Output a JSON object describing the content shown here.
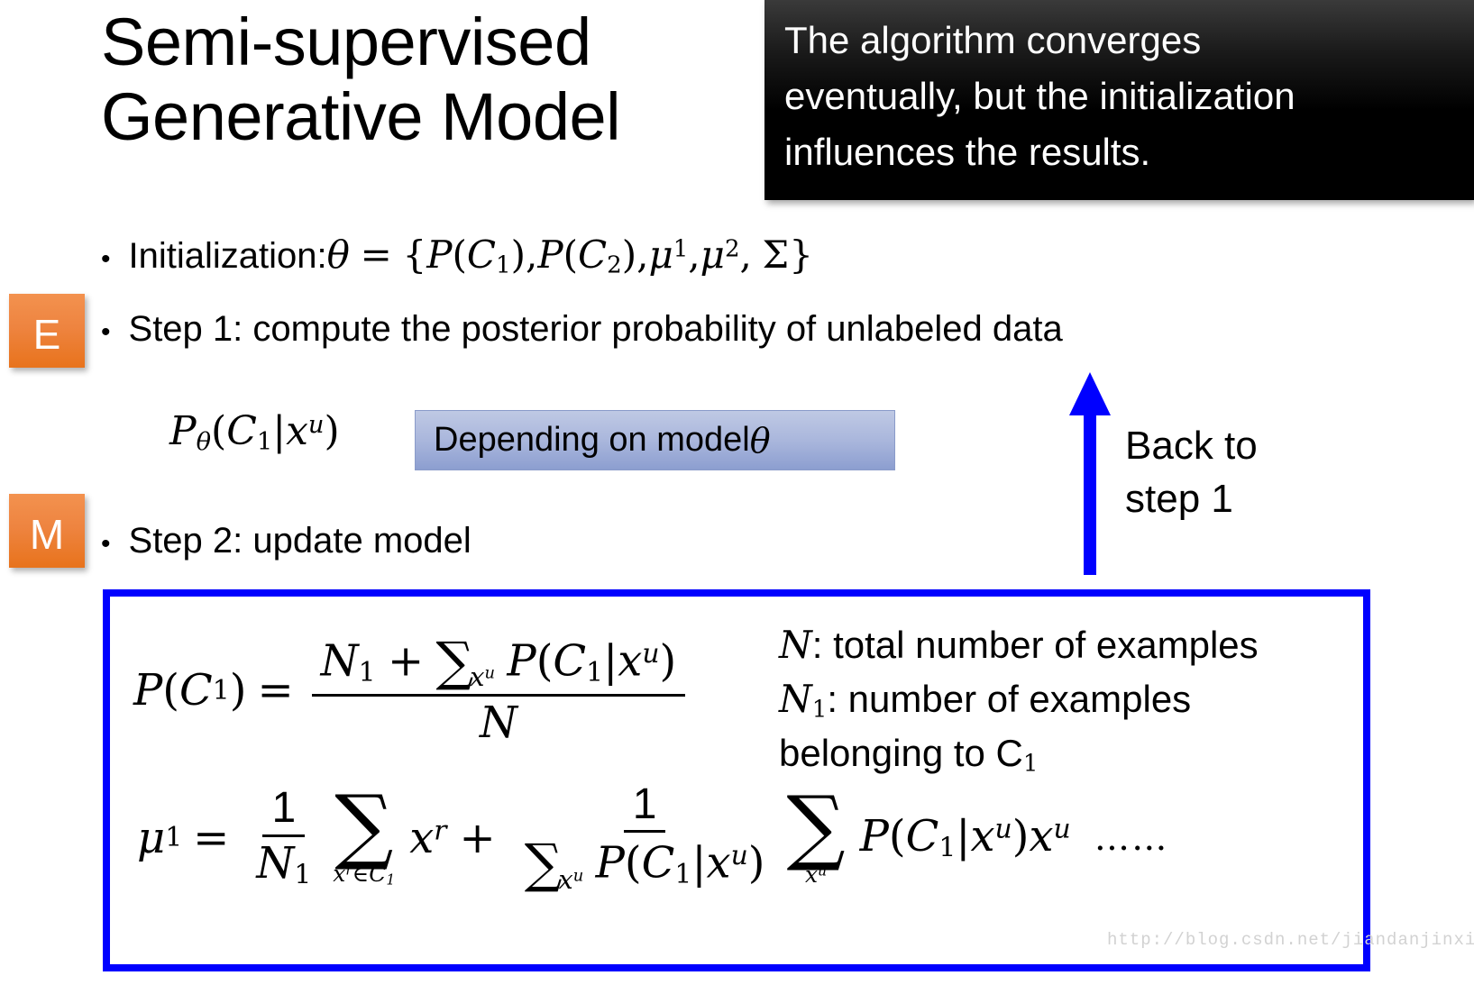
{
  "slide": {
    "title_line1": "Semi-supervised",
    "title_line2": "Generative Model",
    "watermark": "http://blog.csdn.net/jiandanjinxin"
  },
  "callout": {
    "line1": "The algorithm converges",
    "line2": "eventually, but the initialization",
    "line3": "influences the results.",
    "background": "#000000",
    "text_color": "#ffffff"
  },
  "badges": {
    "e_label": "E",
    "m_label": "M",
    "color_top": "#F3924F",
    "color_bottom": "#E8731C"
  },
  "bullets": {
    "dot": "•",
    "init_label": "Initialization:",
    "init_formula": {
      "theta": "θ",
      "equals": "=",
      "open_brace": "{",
      "p1": "P",
      "c1": "C",
      "c1_sub": "1",
      "p2": "P",
      "c2": "C",
      "c2_sub": "2",
      "mu": "μ",
      "mu1_sup": "1",
      "mu2_sup": "2",
      "sigma": "Σ",
      "close_brace": "}",
      "comma": ","
    },
    "step1_text": "Step 1: compute the posterior probability of unlabeled data",
    "step2_text": "Step 2: update model"
  },
  "posterior": {
    "p": "P",
    "theta_sub": "θ",
    "c": "C",
    "c_sub": "1",
    "bar": "|",
    "x": "x",
    "x_sup": "u"
  },
  "depend_box": {
    "text_prefix": "Depending on model ",
    "theta": "θ",
    "fill_top": "#BFC9E4",
    "fill_bottom": "#8C9ED0"
  },
  "back_to_step": {
    "line1": "Back to",
    "line2": "step 1",
    "arrow_color": "#0000FF",
    "arrow_direction": "up"
  },
  "formula_box": {
    "border_color": "#0000FF",
    "equation_pc1": {
      "lhs_p": "P",
      "lhs_c": "C",
      "lhs_c_sub": "1",
      "equals": "=",
      "num_n1": "N",
      "num_n1_sub": "1",
      "plus": "+",
      "sum": "∑",
      "sum_lim_x": "x",
      "sum_lim_sup": "u",
      "num_p": "P",
      "num_c": "C",
      "num_c_sub": "1",
      "bar": "|",
      "num_x": "x",
      "num_x_sup": "u",
      "den_n": "N"
    },
    "equation_mu1": {
      "mu": "μ",
      "mu_sup": "1",
      "equals": "=",
      "frac1_num": "1",
      "frac1_den_n": "N",
      "frac1_den_sub": "1",
      "sum1": "∑",
      "sum1_lim_x": "x",
      "sum1_lim_sup": "r",
      "sum1_lim_in": "∈",
      "sum1_lim_c": "C",
      "sum1_lim_c_sub": "1",
      "term_x": "x",
      "term_x_sup": "r",
      "plus": "+",
      "frac2_num": "1",
      "frac2_den_sum": "∑",
      "frac2_den_lim_x": "x",
      "frac2_den_lim_sup": "u",
      "frac2_den_p": "P",
      "frac2_den_c": "C",
      "frac2_den_c_sub": "1",
      "bar": "|",
      "frac2_den_x": "x",
      "frac2_den_x_sup": "u",
      "sum2": "∑",
      "sum2_lim_x": "x",
      "sum2_lim_sup": "u",
      "tail_p": "P",
      "tail_c": "C",
      "tail_c_sub": "1",
      "tail_x": "x",
      "tail_x_sup": "u",
      "tail_x2": "x",
      "tail_x2_sup": "u",
      "ellipsis": "……"
    },
    "legend": {
      "n_symbol": "N",
      "n_desc": ": total number of examples",
      "n1_symbol": "N",
      "n1_sub": "1",
      "n1_desc": ": number of examples",
      "n1_desc2": "belonging to C",
      "n1_desc2_sub": "1"
    }
  }
}
